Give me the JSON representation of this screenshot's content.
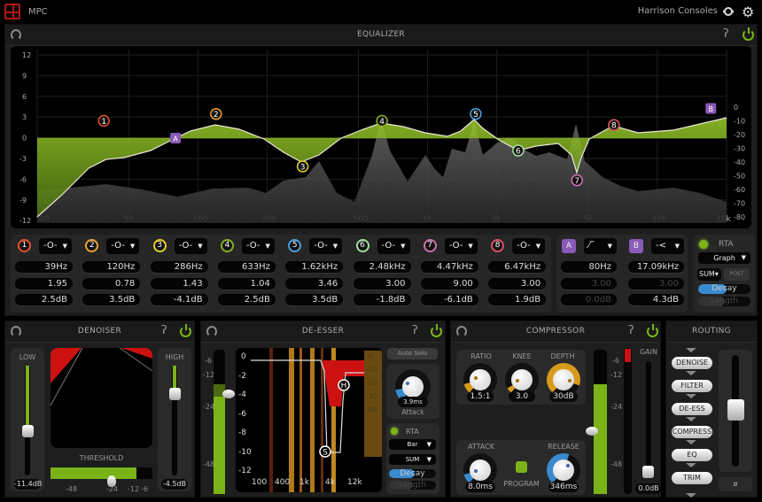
{
  "app": {
    "title": "MPC",
    "brand": "Harrison Consoles"
  },
  "colors": {
    "accent": "#7ab317",
    "filter": "#8a5ab8",
    "reduction": "#cc1111",
    "orange": "#d89a1a",
    "blue": "#3a8ad0"
  },
  "eq": {
    "title": "EQUALIZER",
    "left_axis": [
      "12",
      "9",
      "6",
      "3",
      "0",
      "-3",
      "-6",
      "-9",
      "-12"
    ],
    "right_axis": [
      "0",
      "-10",
      "-20",
      "-30",
      "-40",
      "-50",
      "-60",
      "-70",
      "-80"
    ],
    "freq_axis": [
      {
        "label": "20",
        "f": 20
      },
      {
        "label": "50",
        "f": 50
      },
      {
        "label": "100",
        "f": 100
      },
      {
        "label": "200",
        "f": 200
      },
      {
        "label": "500",
        "f": 500
      },
      {
        "label": "1k",
        "f": 1000
      },
      {
        "label": "2k",
        "f": 2000
      },
      {
        "label": "5k",
        "f": 5000
      },
      {
        "label": "10k",
        "f": 10000
      },
      {
        "label": "20k",
        "f": 20000
      }
    ],
    "bands": [
      {
        "num": "1",
        "color": "#e8502a",
        "type_icon": "bell-icon",
        "freq": "39Hz",
        "q": "1.95",
        "gain": "2.5dB",
        "f": 39,
        "g": 2.5
      },
      {
        "num": "2",
        "color": "#f0a030",
        "type_icon": "bell-icon",
        "freq": "120Hz",
        "q": "0.78",
        "gain": "3.5dB",
        "f": 120,
        "g": 3.5
      },
      {
        "num": "3",
        "color": "#e8d020",
        "type_icon": "bell-icon",
        "freq": "286Hz",
        "q": "1.43",
        "gain": "-4.1dB",
        "f": 286,
        "g": -4.1
      },
      {
        "num": "4",
        "color": "#8ab020",
        "type_icon": "bell-icon",
        "freq": "633Hz",
        "q": "1.04",
        "gain": "2.5dB",
        "f": 633,
        "g": 2.5
      },
      {
        "num": "5",
        "color": "#4aa0e0",
        "type_icon": "bell-icon",
        "freq": "1.62kHz",
        "q": "3.46",
        "gain": "3.5dB",
        "f": 1620,
        "g": 3.5
      },
      {
        "num": "6",
        "color": "#a0e0a0",
        "type_icon": "bell-icon",
        "freq": "2.48kHz",
        "q": "3.00",
        "gain": "-1.8dB",
        "f": 2480,
        "g": -1.8
      },
      {
        "num": "7",
        "color": "#d070b0",
        "type_icon": "bell-icon",
        "freq": "4.47kHz",
        "q": "9.00",
        "gain": "-6.1dB",
        "f": 4470,
        "g": -6.1
      },
      {
        "num": "8",
        "color": "#e05060",
        "type_icon": "bell-icon",
        "freq": "6.47kHz",
        "q": "3.00",
        "gain": "1.9dB",
        "f": 6470,
        "g": 1.9
      }
    ],
    "filters": [
      {
        "label": "A",
        "type_icon": "highpass-icon",
        "freq": "80Hz",
        "q": "3.00",
        "gain": "0.0dB",
        "f": 80,
        "g": 0
      },
      {
        "label": "B",
        "type_icon": "highshelf-icon",
        "freq": "17.09kHz",
        "q": "3.00",
        "gain": "4.3dB",
        "f": 17090,
        "g": 4.3
      }
    ],
    "rta": {
      "label": "RTA",
      "mode": "Graph",
      "source": "SUM",
      "post": "POST",
      "decay": "Decay",
      "decay_level": 0.55,
      "length": "Length",
      "length_level": 0.5
    }
  },
  "denoiser": {
    "title": "DENOISER",
    "low_label": "LOW",
    "low_value": "-11.4dB",
    "low_level": 0.35,
    "high_label": "HIGH",
    "high_value": "-4.5dB",
    "high_level": 0.75,
    "threshold_label": "THRESHOLD",
    "threshold_ticks": [
      "-48",
      "-24",
      "-12",
      "-6"
    ],
    "threshold_level": 0.68
  },
  "deesser": {
    "title": "DE-ESSER",
    "meter_ticks": [
      "-6",
      "-12",
      "-24",
      "-48"
    ],
    "y_axis": [
      "0",
      "-2",
      "-4",
      "-6",
      "-8",
      "-10",
      "-12"
    ],
    "x_axis": [
      "100",
      "400",
      "1k",
      "4k",
      "12k"
    ],
    "gr_axis": [
      "0",
      "-10",
      "-20",
      "-30",
      "-40"
    ],
    "nodes": [
      "H",
      "S"
    ],
    "auto_solo": "Auto Solo",
    "attack_value": "3.9ms",
    "attack_label": "Attack",
    "rta": {
      "label": "RTA",
      "mode": "Bar",
      "source": "SUM",
      "decay": "Decay",
      "length": "Length"
    }
  },
  "compressor": {
    "title": "COMPRESSOR",
    "ratio_label": "RATIO",
    "ratio": "1.5:1",
    "knee_label": "KNEE",
    "knee": "3.0",
    "depth_label": "DEPTH",
    "depth": "30dB",
    "attack_label": "ATTACK",
    "attack": "8.0ms",
    "release_label": "RELEASE",
    "release": "346ms",
    "program": "PROGRAM",
    "meter_ticks": [
      "-6",
      "-12",
      "-24",
      "-48"
    ],
    "gain_label": "GAIN",
    "gain_value": "0.0dB"
  },
  "routing": {
    "title": "ROUTING",
    "items": [
      "DENOISE",
      "FILTER",
      "DE-ESS",
      "COMPRESS",
      "EQ",
      "TRIM"
    ],
    "phase": "ø"
  }
}
